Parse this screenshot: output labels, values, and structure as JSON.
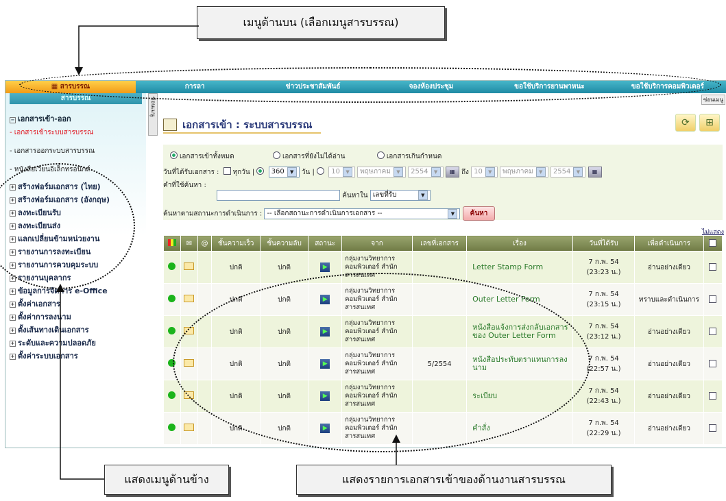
{
  "callouts": {
    "top": "เมนูด้านบน (เลือกเมนูสารบรรณ)",
    "side": "แสดงเมนูด้านข้าง",
    "list": "แสดงรายการเอกสารเข้าของด้านงานสารบรรณ"
  },
  "topnav": [
    "สารบรรณ",
    "การลา",
    "ข่าวประชาสัมพันธ์",
    "จองห้องประชุม",
    "ขอใช้บริการยานพาหนะ",
    "ขอใช้บริการคอมพิวเตอร์"
  ],
  "topnav_tail": "ซ่อนเมนู",
  "sidebar": {
    "header": "สารบรรณ",
    "group": "เอกสารเข้า-ออก",
    "subs": [
      "- เอกสารเข้าระบบสารบรรณ",
      "- เอกสารออกระบบสารบรรณ",
      "- หนังสือเวียนอิเล็กทรอนิกส์"
    ],
    "items": [
      "สร้างฟอร์มเอกสาร (ไทย)",
      "สร้างฟอร์มเอกสาร (อังกฤษ)",
      "ลงทะเบียนรับ",
      "ลงทะเบียนส่ง",
      "แลกเปลี่ยนข้ามหน่วยงาน",
      "รายงานการลงทะเบียน",
      "รายงานการควบคุมระบบ",
      "รายงานบุคลากร",
      "ข้อมูลการจัดการ e-Office",
      "ตั้งค่าเอกสาร",
      "ตั้งค่าการลงนาม",
      "ตั้งเส้นทางเดินเอกสาร",
      "ระดับและความปลอดภัย",
      "ตั้งค่าระบบเอกสาร"
    ],
    "collapse_label": "ซ่อนเมนู"
  },
  "main": {
    "title": "เอกสารเข้า : ระบบสารบรรณ",
    "filters": {
      "radio_all": "เอกสารเข้าทั้งหมด",
      "radio_unread": "เอกสารที่ยังไม่ได้อ่าน",
      "radio_overdue": "เอกสารเกินกำหนด",
      "date_label": "วันที่ได้รับเอกสาร :",
      "every_day": "ทุกวัน",
      "days_value": "360",
      "days_unit": "วัน",
      "from_day": "10",
      "from_month": "พฤษภาคม",
      "from_year": "2554",
      "to_label": "ถึง",
      "to_day": "10",
      "to_month": "พฤษภาคม",
      "to_year": "2554",
      "keyword_label": "คำที่ใช้ค้นหา :",
      "search_in_label": "ค้นหาใน",
      "search_in_value": "เลขที่รับ",
      "status_label": "ค้นหาตามสถานะการดำเนินการ :",
      "status_value": "-- เลือกสถานะการดำเนินการเอกสาร --",
      "search_button": "ค้นหา"
    },
    "hide_link": "ไม่แสดง",
    "columns": [
      "ชั้นความเร็ว",
      "ชั้นความลับ",
      "สถานะ",
      "จาก",
      "เลขที่เอกสาร",
      "เรื่อง",
      "วันที่ได้รับ",
      "เพื่อดำเนินการ"
    ],
    "rows": [
      {
        "speed": "ปกติ",
        "secret": "ปกติ",
        "from": "กลุ่มงานวิทยาการคอมพิวเตอร์ สำนักสารสนเทศ",
        "docno": "",
        "subject": "Letter Stamp Form",
        "date": "7 ก.พ. 54",
        "time": "(23:23 น.)",
        "action": "อ่านอย่างเดียว"
      },
      {
        "speed": "ปกติ",
        "secret": "ปกติ",
        "from": "กลุ่มงานวิทยาการคอมพิวเตอร์ สำนักสารสนเทศ",
        "docno": "",
        "subject": "Outer Letter Form",
        "date": "7 ก.พ. 54",
        "time": "(23:15 น.)",
        "action": "ทราบและดำเนินการ"
      },
      {
        "speed": "ปกติ",
        "secret": "ปกติ",
        "from": "กลุ่มงานวิทยาการคอมพิวเตอร์ สำนักสารสนเทศ",
        "docno": "",
        "subject": "หนังสือแจ้งการส่งกลับเอกสารของ Outer Letter Form",
        "date": "7 ก.พ. 54",
        "time": "(23:12 น.)",
        "action": "อ่านอย่างเดียว"
      },
      {
        "speed": "ปกติ",
        "secret": "ปกติ",
        "from": "กลุ่มงานวิทยาการคอมพิวเตอร์ สำนักสารสนเทศ",
        "docno": "5/2554",
        "subject": "หนังสือประทับตราแทนการลงนาม",
        "date": "7 ก.พ. 54",
        "time": "(22:57 น.)",
        "action": "อ่านอย่างเดียว"
      },
      {
        "speed": "ปกติ",
        "secret": "ปกติ",
        "from": "กลุ่มงานวิทยาการคอมพิวเตอร์ สำนักสารสนเทศ",
        "docno": "",
        "subject": "ระเบียบ",
        "date": "7 ก.พ. 54",
        "time": "(22:43 น.)",
        "action": "อ่านอย่างเดียว"
      },
      {
        "speed": "ปกติ",
        "secret": "ปกติ",
        "from": "กลุ่มงานวิทยาการคอมพิวเตอร์ สำนักสารสนเทศ",
        "docno": "",
        "subject": "คำสั่ง",
        "date": "7 ก.พ. 54",
        "time": "(22:29 น.)",
        "action": "อ่านอย่างเดียว"
      }
    ]
  }
}
